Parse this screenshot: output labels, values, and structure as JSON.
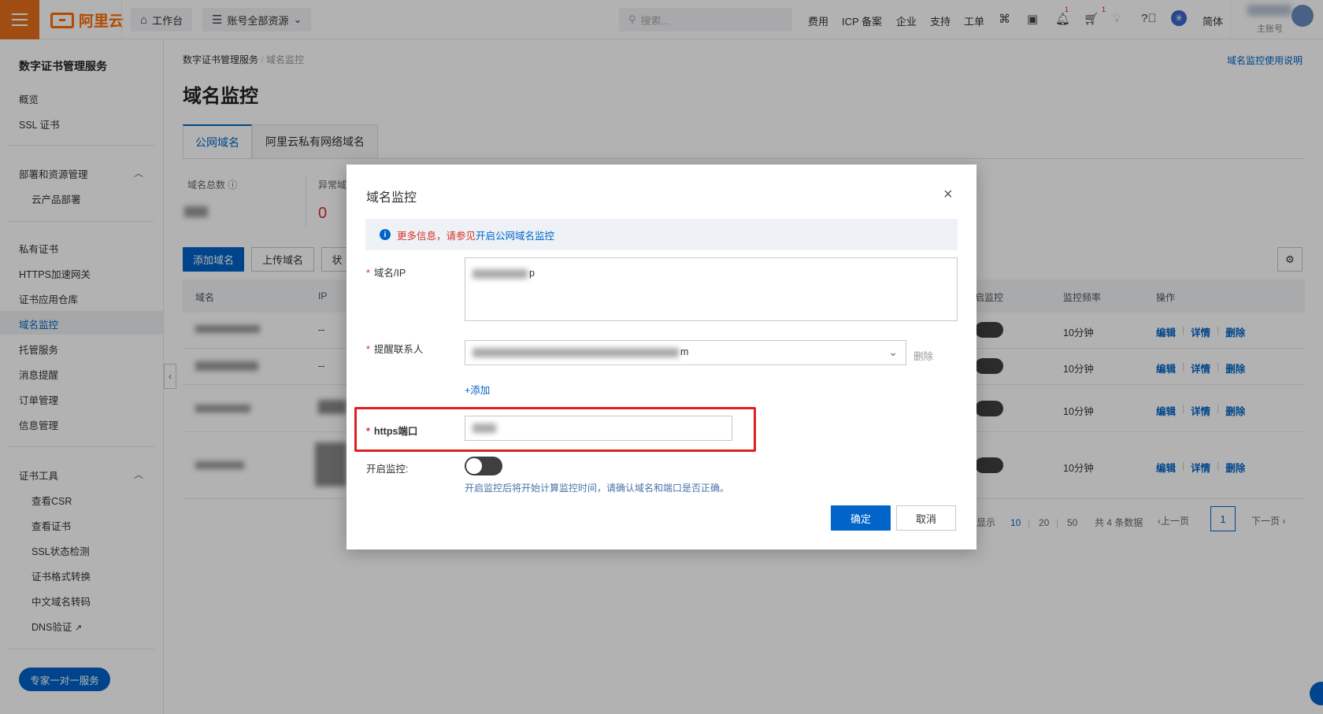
{
  "topbar": {
    "brand": "阿里云",
    "workbench": "工作台",
    "resource_scope": "账号全部资源",
    "search_placeholder": "搜索...",
    "nav": [
      "费用",
      "ICP 备案",
      "企业",
      "支持",
      "工单"
    ],
    "notification_count": "1",
    "cart_count": "1",
    "language": "简体",
    "account_type": "主账号"
  },
  "sidebar": {
    "title": "数字证书管理服务",
    "items": [
      "概览",
      "SSL 证书"
    ],
    "group1": {
      "label": "部署和资源管理",
      "sub": [
        "云产品部署"
      ]
    },
    "items2": [
      "私有证书",
      "HTTPS加速网关",
      "证书应用仓库",
      "域名监控",
      "托管服务",
      "消息提醒",
      "订单管理",
      "信息管理"
    ],
    "group2": {
      "label": "证书工具",
      "sub": [
        "查看CSR",
        "查看证书",
        "SSL状态检测",
        "证书格式转换",
        "中文域名转码",
        "DNS验证"
      ]
    },
    "expert_button": "专家一对一服务"
  },
  "main": {
    "breadcrumb": [
      "数字证书管理服务",
      "域名监控"
    ],
    "help_link": "域名监控使用说明",
    "title": "域名监控",
    "tabs": [
      "公网域名",
      "阿里云私有网络域名"
    ],
    "stats": {
      "total_label": "域名总数",
      "abnormal_label": "异常域",
      "abnormal_value": "0"
    },
    "toolbar": {
      "add": "添加域名",
      "upload": "上传域名",
      "status_partial": "状"
    },
    "table": {
      "headers": [
        "域名",
        "IP",
        "启监控",
        "监控频率",
        "操作"
      ],
      "rows": [
        {
          "ip": "--",
          "freq": "10分钟"
        },
        {
          "ip": "--",
          "freq": "10分钟"
        },
        {
          "ip": "",
          "freq": "10分钟"
        },
        {
          "ip": "",
          "freq": "10分钟"
        }
      ],
      "ops": {
        "edit": "编辑",
        "detail": "详情",
        "delete": "删除"
      }
    },
    "pagination": {
      "show_label": "显示",
      "sizes": [
        "10",
        "20",
        "50"
      ],
      "total": "共 4 条数据",
      "prev": "上一页",
      "current": "1",
      "next": "下一页"
    }
  },
  "dialog": {
    "title": "域名监控",
    "notice_red": "更多信息，请参见",
    "notice_link": "开启公网域名监控",
    "domain_label": "域名/IP",
    "domain_tail": "p",
    "contact_label": "提醒联系人",
    "contact_tail": "m",
    "delete_label": "删除",
    "add_label": "+添加",
    "port_label": "https端口",
    "monitor_label": "开启监控:",
    "monitor_hint": "开启监控后将开始计算监控时间，请确认域名和端口是否正确。",
    "ok": "确定",
    "cancel": "取消"
  }
}
